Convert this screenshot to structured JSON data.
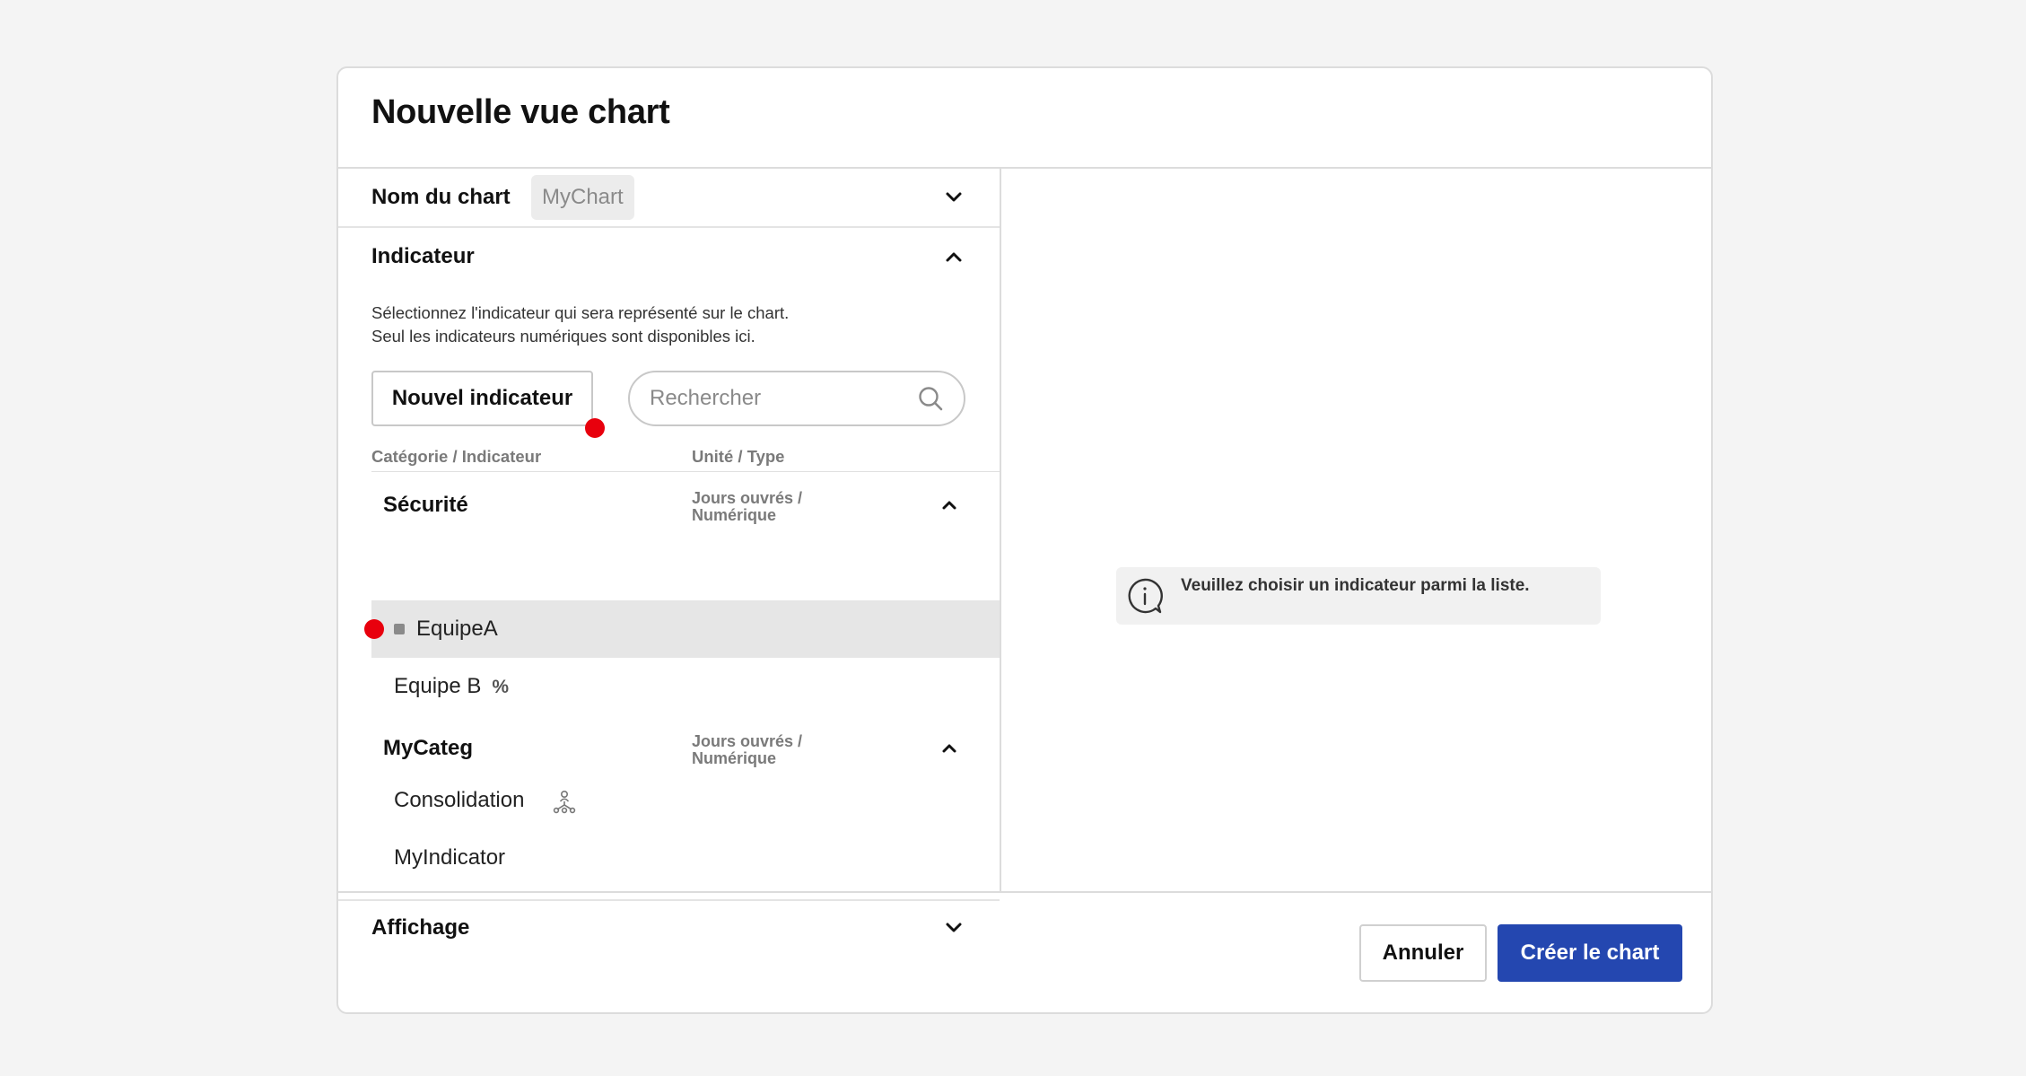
{
  "dialog": {
    "title": "Nouvelle vue chart"
  },
  "chart_name": {
    "label": "Nom du chart",
    "value": "MyChart"
  },
  "indicator_section": {
    "label": "Indicateur",
    "description_line1": "Sélectionnez l'indicateur qui sera représenté sur le chart.",
    "description_line2": "Seul les indicateurs numériques sont disponibles ici.",
    "new_button": "Nouvel indicateur",
    "search_placeholder": "Rechercher",
    "col_category": "Catégorie / Indicateur",
    "col_type": "Unité / Type",
    "categories": [
      {
        "name": "Sécurité",
        "type_line1": "Jours ouvrés /",
        "type_line2": "Numérique",
        "items": [
          {
            "label": "EquipeA",
            "selected": true
          },
          {
            "label": "Equipe B",
            "suffix": "%"
          }
        ]
      },
      {
        "name": "MyCateg",
        "type_line1": "Jours ouvrés /",
        "type_line2": "Numérique",
        "items": [
          {
            "label": "Consolidation",
            "icon": "hierarchy-icon"
          },
          {
            "label": "MyIndicator"
          }
        ]
      }
    ]
  },
  "display_section": {
    "label": "Affichage"
  },
  "preview": {
    "info_message": "Veuillez choisir un indicateur parmi la liste."
  },
  "footer": {
    "cancel_label": "Annuler",
    "create_label": "Créer le chart"
  },
  "colors": {
    "primary": "#2447b0",
    "marker": "#e8000d",
    "selected_row": "#e6e6e6"
  }
}
